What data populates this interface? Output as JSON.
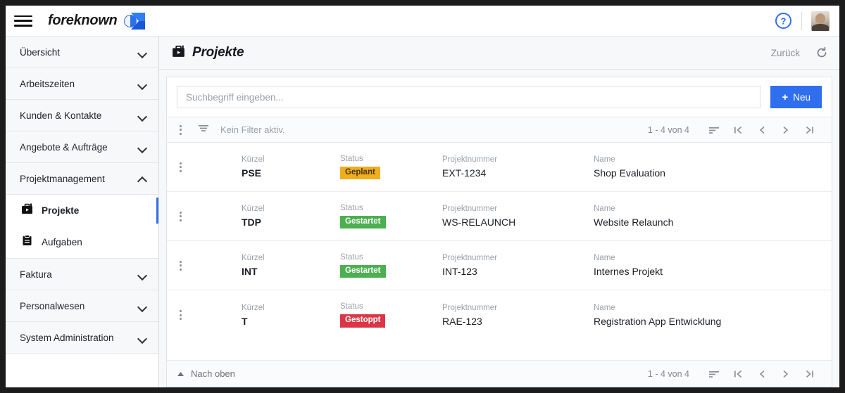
{
  "topbar": {
    "menu_icon": "hamburger-icon",
    "brand_text": "foreknown",
    "brand_logo": "foreknown-logo",
    "help_icon": "help-circle-icon",
    "avatar": "user-avatar"
  },
  "sidebar": {
    "groups": [
      {
        "label": "Übersicht",
        "expanded": false
      },
      {
        "label": "Arbeitszeiten",
        "expanded": false
      },
      {
        "label": "Kunden & Kontakte",
        "expanded": false
      },
      {
        "label": "Angebote & Aufträge",
        "expanded": false
      },
      {
        "label": "Projektmanagement",
        "expanded": true
      },
      {
        "label": "Faktura",
        "expanded": false
      },
      {
        "label": "Personalwesen",
        "expanded": false
      },
      {
        "label": "System Administration",
        "expanded": false
      }
    ],
    "subitems": [
      {
        "label": "Projekte",
        "icon": "briefcase-icon",
        "active": true
      },
      {
        "label": "Aufgaben",
        "icon": "clipboard-icon",
        "active": false
      }
    ]
  },
  "page": {
    "title": "Projekte",
    "title_icon": "briefcase-icon",
    "back_label": "Zurück",
    "refresh_icon": "refresh-icon"
  },
  "search": {
    "placeholder": "Suchbegriff eingeben...",
    "value": "",
    "new_button_label": "Neu",
    "new_button_plus": "+"
  },
  "toolbar": {
    "kebab_icon": "more-vertical-icon",
    "filter_icon": "filter-icon",
    "filter_text": "Kein Filter aktiv.",
    "pager_count": "1 - 4 von 4",
    "sort_icon": "sort-icon",
    "first_icon": "first-page-icon",
    "prev_icon": "prev-page-icon",
    "next_icon": "next-page-icon",
    "last_icon": "last-page-icon"
  },
  "table": {
    "columns": {
      "kuerzel": "Kürzel",
      "status": "Status",
      "projektnummer": "Projektnummer",
      "name": "Name"
    },
    "rows": [
      {
        "kuerzel": "PSE",
        "status": "Geplant",
        "status_kind": "geplant",
        "projektnummer": "EXT-1234",
        "name": "Shop Evaluation"
      },
      {
        "kuerzel": "TDP",
        "status": "Gestartet",
        "status_kind": "gestartet",
        "projektnummer": "WS-RELAUNCH",
        "name": "Website Relaunch"
      },
      {
        "kuerzel": "INT",
        "status": "Gestartet",
        "status_kind": "gestartet",
        "projektnummer": "INT-123",
        "name": "Internes Projekt"
      },
      {
        "kuerzel": "T",
        "status": "Gestoppt",
        "status_kind": "gestoppt",
        "projektnummer": "RAE-123",
        "name": "Registration App Entwicklung"
      }
    ]
  },
  "footer": {
    "top_label": "Nach oben",
    "top_icon": "arrow-up-icon",
    "pager_count": "1 - 4 von 4"
  },
  "colors": {
    "accent": "#2f6fed",
    "geplant": "#efae1e",
    "gestartet": "#4caf50",
    "gestoppt": "#dc3545"
  }
}
